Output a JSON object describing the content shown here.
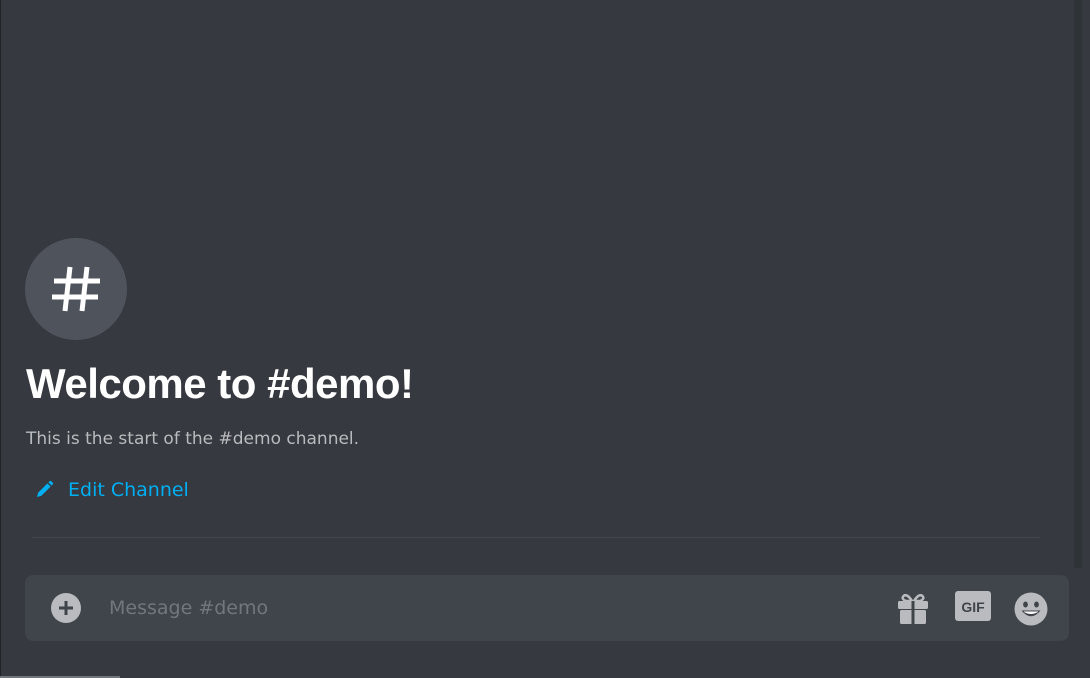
{
  "channel": {
    "hash_symbol": "#",
    "welcome_title": "Welcome to #demo!",
    "welcome_description": "This is the start of the #demo channel.",
    "edit_label": "Edit Channel"
  },
  "composer": {
    "placeholder": "Message #demo",
    "gif_label": "GIF"
  },
  "icons": {
    "attach": "plus-circle-icon",
    "edit": "pencil-icon",
    "gift": "gift-icon",
    "gif": "gif-icon",
    "emoji": "smiley-emoji-icon"
  },
  "colors": {
    "background": "#36393f",
    "composer_background": "#40444b",
    "link": "#00aff4",
    "title": "#ffffff",
    "muted_text": "#b9bbbe",
    "placeholder": "#72767d",
    "icon": "#b9bbbe"
  }
}
